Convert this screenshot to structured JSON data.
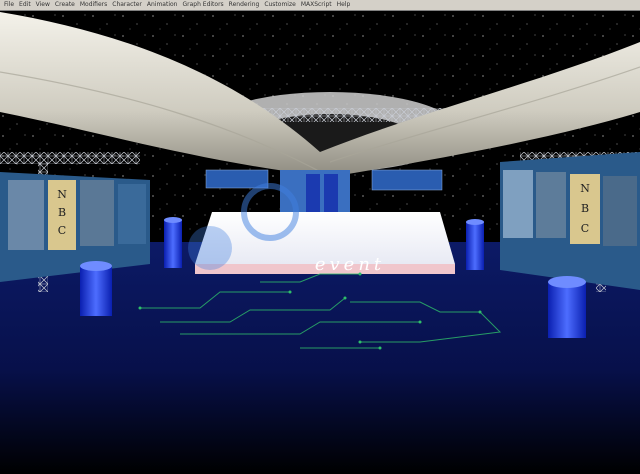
{
  "menubar": {
    "items": [
      "File",
      "Edit",
      "View",
      "Create",
      "Modifiers",
      "Character",
      "Animation",
      "Graph Editors",
      "Rendering",
      "Customize",
      "MAXScript",
      "Help"
    ]
  },
  "viewport": {
    "stage_logo_text": "event",
    "left_panel_letters": [
      "N",
      "B",
      "C"
    ],
    "right_panel_letters": [
      "N",
      "B",
      "C"
    ],
    "colors": {
      "stage_floor": "#0a1240",
      "stage_top": "#ffffff",
      "drape": "#e8e6dc",
      "truss": "#bfc4cc",
      "cylinder": "#2a4dff",
      "circuit": "#2fbf6a"
    }
  }
}
